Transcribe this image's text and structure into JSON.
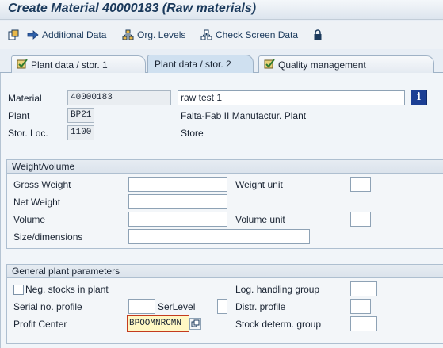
{
  "window": {
    "title": "Create Material 40000183 (Raw materials)"
  },
  "toolbar": {
    "additional_data": "Additional Data",
    "org_levels": "Org. Levels",
    "check_screen_data": "Check Screen Data"
  },
  "tabs": [
    {
      "label": "Plant data / stor. 1",
      "active": false
    },
    {
      "label": "Plant data / stor. 2",
      "active": true
    },
    {
      "label": "Quality management",
      "active": false
    }
  ],
  "header": {
    "material_label": "Material",
    "material_value": "40000183",
    "material_desc": "raw test 1",
    "plant_label": "Plant",
    "plant_value": "BP21",
    "plant_desc": "Falta-Fab II Manufactur. Plant",
    "storloc_label": "Stor. Loc.",
    "storloc_value": "1100",
    "storloc_desc": "Store"
  },
  "weight_volume": {
    "title": "Weight/volume",
    "gross_weight_label": "Gross Weight",
    "weight_unit_label": "Weight unit",
    "net_weight_label": "Net Weight",
    "volume_label": "Volume",
    "volume_unit_label": "Volume unit",
    "size_dimensions_label": "Size/dimensions"
  },
  "general_plant": {
    "title": "General plant parameters",
    "neg_stocks_label": "Neg. stocks in plant",
    "neg_stocks_checked": false,
    "log_handling_label": "Log. handling group",
    "serial_profile_label": "Serial no. profile",
    "serlevel_label": "SerLevel",
    "distr_profile_label": "Distr. profile",
    "profit_center_label": "Profit Center",
    "profit_center_value": "BPOOMNRCMN",
    "stock_determ_label": "Stock determ. group"
  },
  "colors": {
    "accent": "#1b3a5c",
    "active_tab": "#cfe0f0",
    "required_border": "#c43b1e",
    "required_bg": "#fff8c4"
  }
}
